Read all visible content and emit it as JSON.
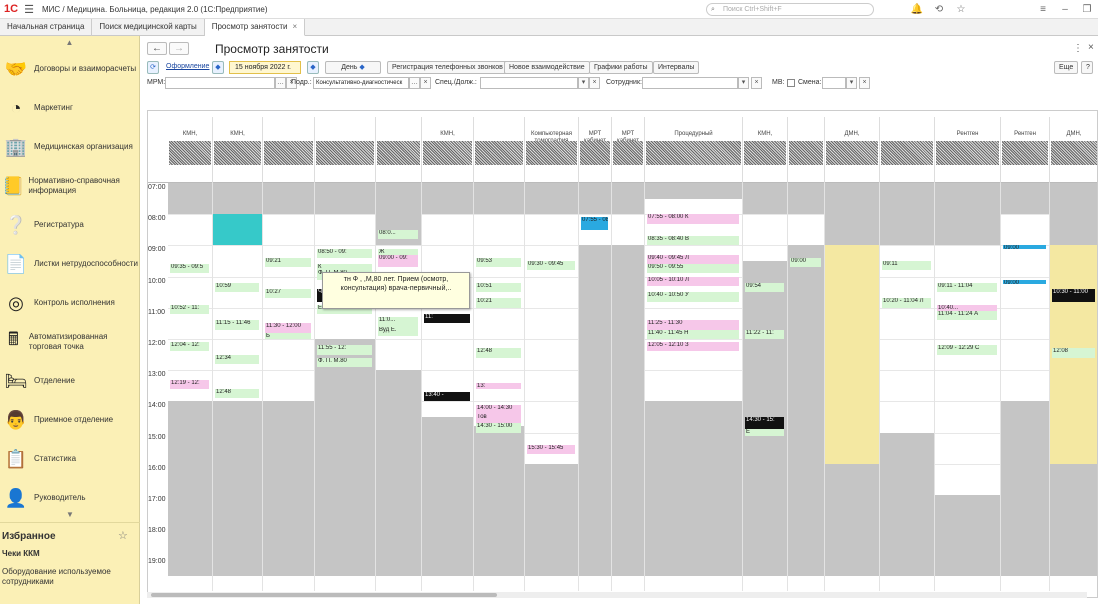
{
  "app": {
    "title": "МИС / Медицина. Больница, редакция 2.0  (1С:Предприятие)",
    "search_placeholder": "Поиск Ctrl+Shift+F"
  },
  "tabs": [
    {
      "label": "Начальная страница"
    },
    {
      "label": "Поиск медицинской карты"
    },
    {
      "label": "Просмотр занятости",
      "active": true
    }
  ],
  "sidebar": {
    "items": [
      {
        "label": "Договоры и взаиморасчеты",
        "icon": "handshake-icon",
        "glyph": "🤝"
      },
      {
        "label": "Маркетинг",
        "icon": "chart-pie-icon",
        "glyph": "◔"
      },
      {
        "label": "Медицинская организация",
        "icon": "building-icon",
        "glyph": "🏢"
      },
      {
        "label": "Нормативно-справочная информация",
        "icon": "book-icon",
        "glyph": "📒"
      },
      {
        "label": "Регистратура",
        "icon": "question-book-icon",
        "glyph": "❔"
      },
      {
        "label": "Листки нетрудоспособности",
        "icon": "document-icon",
        "glyph": "📄"
      },
      {
        "label": "Контроль исполнения",
        "icon": "target-icon",
        "glyph": "◎"
      },
      {
        "label": "Автоматизированная торговая точка",
        "icon": "cash-register-icon",
        "glyph": "🖩"
      },
      {
        "label": "Отделение",
        "icon": "bed-icon",
        "glyph": "🛏"
      },
      {
        "label": "Приемное отделение",
        "icon": "doctor-icon",
        "glyph": "👨"
      },
      {
        "label": "Статистика",
        "icon": "clipboard-icon",
        "glyph": "📋"
      },
      {
        "label": "Руководитель",
        "icon": "person-icon",
        "glyph": "👤"
      }
    ],
    "favorites_title": "Избранное",
    "favorites": [
      "Чеки ККМ",
      "Оборудование используемое сотрудниками"
    ]
  },
  "main": {
    "title": "Просмотр занятости",
    "toolbar": {
      "link": "Оформление",
      "date": "15 ноября 2022 г.",
      "period": "День",
      "buttons": [
        "Регистрация телефонных звонков",
        "Новое взаимодействие",
        "Графики работы",
        "Интервалы"
      ],
      "more": "Еще",
      "help": "?"
    },
    "filters": {
      "mrm_label": "МРМ:",
      "podr_label": "Подр.:",
      "podr_value": "Консультативно-диагностическ",
      "spec_label": "Спец./Долж.:",
      "employee_label": "Сотрудник:",
      "mv_label": "МВ:",
      "shift_label": "Смена:"
    },
    "columns": [
      "КМН,",
      "КМН,",
      "",
      "",
      "",
      "КМН,",
      "",
      "Компьютерная томография",
      "МРТ кабинет",
      "МРТ кабинет",
      "Процедурный",
      "КМН,",
      "",
      "ДМН,",
      "",
      "Рентген",
      "Рентген",
      "ДМН,"
    ],
    "times": [
      "07:00",
      "08:00",
      "09:00",
      "10:00",
      "11:00",
      "12:00",
      "13:00",
      "14:00",
      "15:00",
      "16:00",
      "17:00",
      "18:00",
      "19:00"
    ],
    "events": [
      "09:35 - 09:5",
      "10:59",
      "10:52 - 11:",
      "12:04 - 12:",
      "12:19 - 12:",
      "11:15 - 11:46",
      "12:34",
      "12:48",
      "09:21",
      "10:27",
      "11:30 - 12:00",
      "Б",
      "Ч",
      "08:50 - 09:",
      "К",
      "Ф. П. М.80",
      "Е",
      "11:55 - 12:",
      "Ф. П. М.80",
      "08:0...",
      "Ж",
      "11:0...",
      "Вуд Е.",
      "09:00 - 09:",
      "11:",
      "13:40 -",
      "09:53",
      "10:51",
      "10:21",
      "12:48",
      "14:00 - 14:30",
      "Тов",
      "13:",
      "14:30 - 15:00",
      "09:30 - 09:45",
      "15:30 - 15:45",
      "07:55 - 08:00 К",
      "08:35 - 08:40 В",
      "09:40 - 09:45 Л",
      "09:50 - 09:55",
      "10:05 - 10:10 Л",
      "10:40 - 10:50 У",
      "11:25 - 11:30",
      "11:40 - 11:45 Н",
      "12:05 - 12:10 З",
      "09:54",
      "11:22 - 11:",
      "14:30 - 15:",
      "Е",
      "09:00",
      "09:11",
      "10:20 - 11:04 Л",
      "09:11 - 11:04",
      "10:40...",
      "11:04 - 11:24 А",
      "12:09 - 12:29 С",
      "10:30 - 11:00",
      "12:08"
    ],
    "tooltip": "тн Ф               ,               ,М,80 лет. Прием (осмотр, консультация) врача-первичный,..",
    "colors": {
      "free": "#d6f5d3",
      "booked": "#f6c7e9",
      "unavailable": "#c5c5c5",
      "nonwork": "#f4e8a2",
      "accent": "#fbf0b6"
    }
  }
}
